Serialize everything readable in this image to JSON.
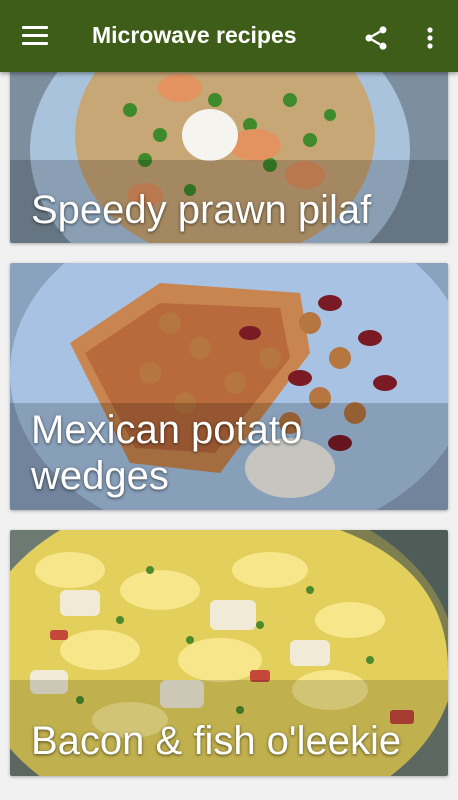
{
  "app_bar": {
    "title": "Microwave recipes",
    "menu_icon": "hamburger-menu-icon",
    "share_icon": "share-icon",
    "more_icon": "more-vert-icon",
    "background_color": "#3e5d18"
  },
  "recipes": [
    {
      "title": "Speedy prawn pilaf"
    },
    {
      "title": "Mexican potato\nwedges"
    },
    {
      "title": "Bacon & fish o'leekie"
    }
  ]
}
